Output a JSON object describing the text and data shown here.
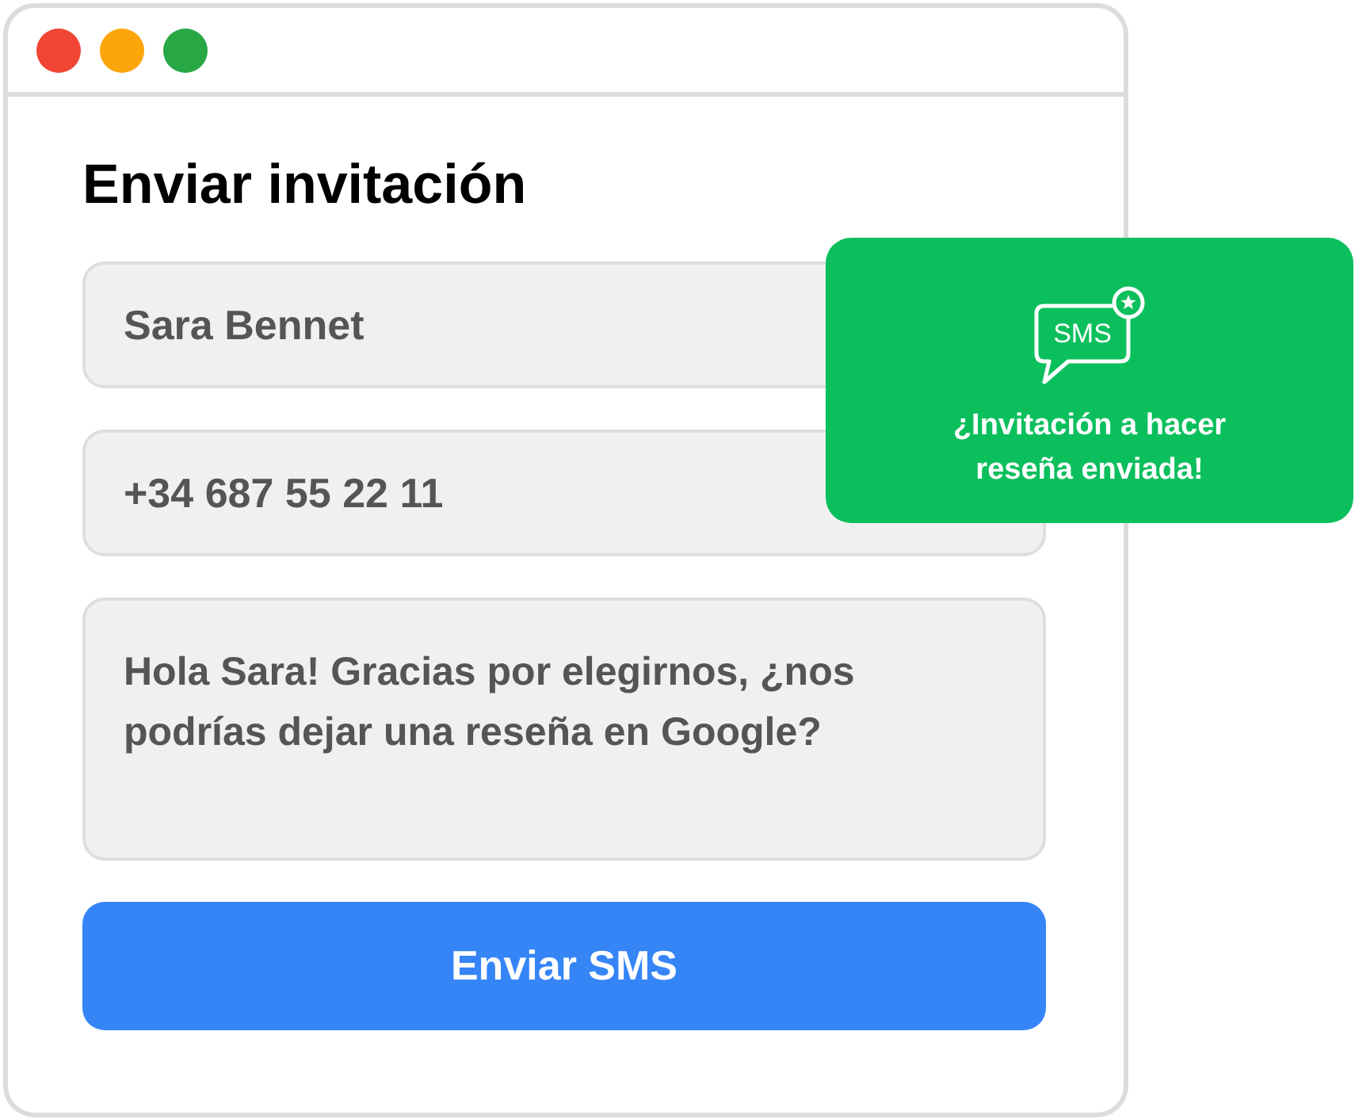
{
  "window": {
    "controls": [
      {
        "color": "#ef4533"
      },
      {
        "color": "#fca60b"
      },
      {
        "color": "#28a745"
      }
    ]
  },
  "form": {
    "title": "Enviar invitación",
    "fields": [
      {
        "kind": "line",
        "value": "Sara Bennet"
      },
      {
        "kind": "line",
        "value": "+34 687 55 22 11"
      },
      {
        "kind": "multiline",
        "value": "Hola Sara! Gracias por elegirnos, ¿nos podrías dejar una reseña en Google?"
      }
    ],
    "submit_button": "Enviar SMS"
  },
  "toast": {
    "icon_label": "SMS",
    "message": "¿Invitación a hacer reseña enviada!"
  }
}
